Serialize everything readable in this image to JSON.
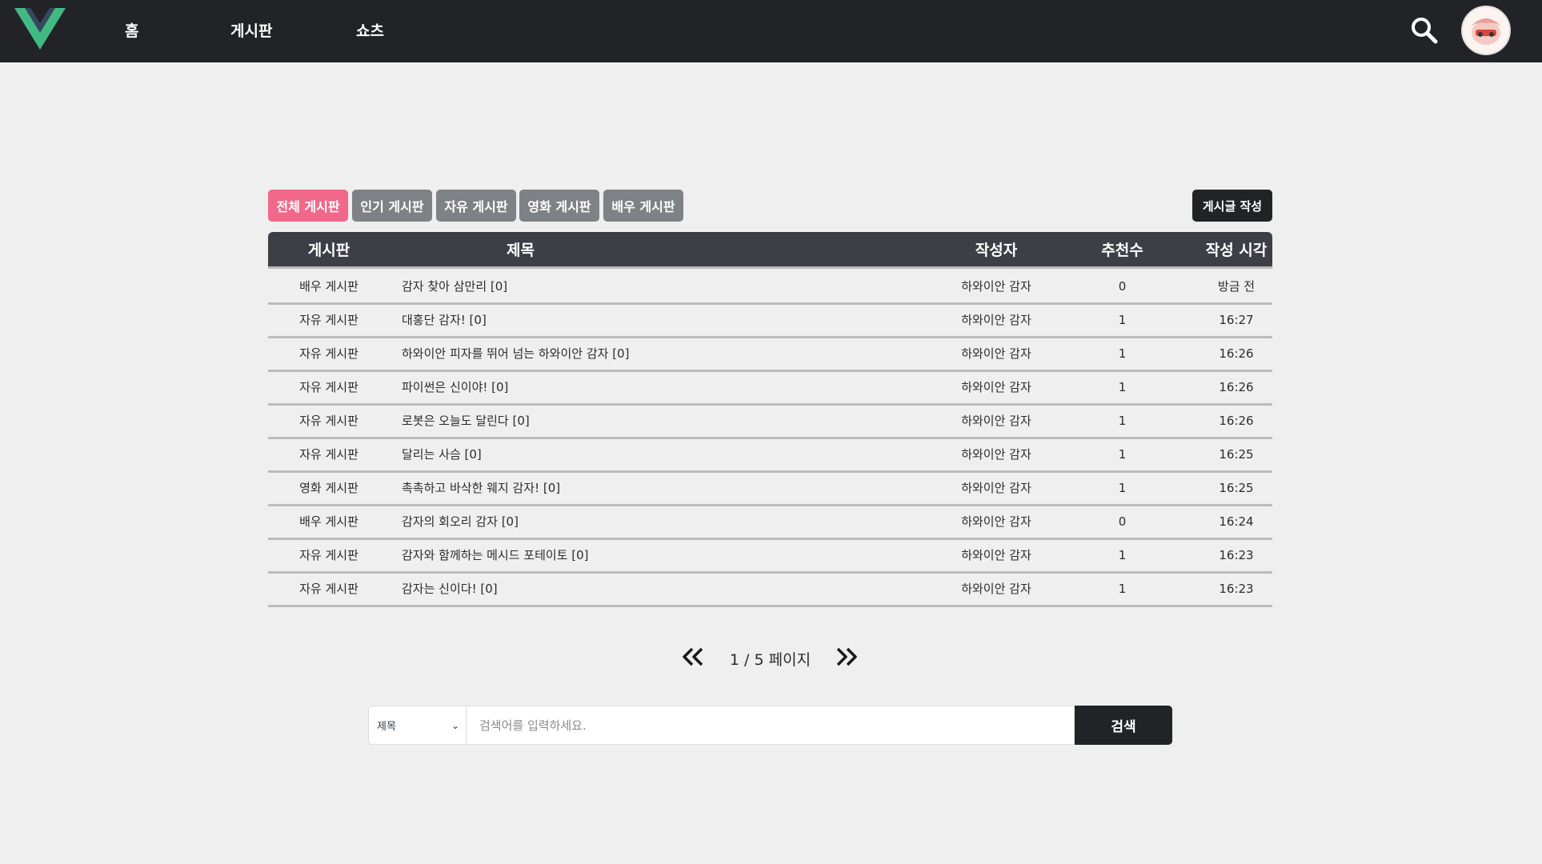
{
  "nav": {
    "links": [
      "홈",
      "게시판",
      "쇼츠"
    ],
    "accent": "#42b883",
    "background": "#212327"
  },
  "tabs": [
    {
      "label": "전체 게시판",
      "active": true
    },
    {
      "label": "인기 게시판",
      "active": false
    },
    {
      "label": "자유 게시판",
      "active": false
    },
    {
      "label": "영화 게시판",
      "active": false
    },
    {
      "label": "배우 게시판",
      "active": false
    }
  ],
  "write_button": "게시글 작성",
  "table": {
    "headers": [
      "게시판",
      "제목",
      "작성자",
      "추천수",
      "작성 시각"
    ],
    "rows": [
      {
        "board": "배우 게시판",
        "title": "감자 찾아 삼만리 [0]",
        "author": "하와이안 감자",
        "votes": "0",
        "time": "방금 전"
      },
      {
        "board": "자유 게시판",
        "title": "대홍단 감자! [0]",
        "author": "하와이안 감자",
        "votes": "1",
        "time": "16:27"
      },
      {
        "board": "자유 게시판",
        "title": "하와이안 피자를 뛰어 넘는 하와이안 감자 [0]",
        "author": "하와이안 감자",
        "votes": "1",
        "time": "16:26"
      },
      {
        "board": "자유 게시판",
        "title": "파이썬은 신이야! [0]",
        "author": "하와이안 감자",
        "votes": "1",
        "time": "16:26"
      },
      {
        "board": "자유 게시판",
        "title": "로봇은 오늘도 달린다 [0]",
        "author": "하와이안 감자",
        "votes": "1",
        "time": "16:26"
      },
      {
        "board": "자유 게시판",
        "title": "달리는 사슴 [0]",
        "author": "하와이안 감자",
        "votes": "1",
        "time": "16:25"
      },
      {
        "board": "영화 게시판",
        "title": "촉촉하고 바삭한 웨지 감자! [0]",
        "author": "하와이안 감자",
        "votes": "1",
        "time": "16:25"
      },
      {
        "board": "배우 게시판",
        "title": "감자의 회오리 감자 [0]",
        "author": "하와이안 감자",
        "votes": "0",
        "time": "16:24"
      },
      {
        "board": "자유 게시판",
        "title": "감자와 함께하는 메시드 포테이토 [0]",
        "author": "하와이안 감자",
        "votes": "1",
        "time": "16:23"
      },
      {
        "board": "자유 게시판",
        "title": "감자는 신이다! [0]",
        "author": "하와이안 감자",
        "votes": "1",
        "time": "16:23"
      }
    ]
  },
  "pagination": {
    "text": "1 / 5 페이지",
    "current": 1,
    "total": 5
  },
  "search": {
    "select_value": "제목",
    "placeholder": "검색어를 입력하세요.",
    "button": "검색"
  },
  "colors": {
    "active_tab": "#f0688a",
    "inactive_tab": "#7e8185",
    "header_bg": "#3c3f45",
    "page_bg": "#efefef"
  }
}
